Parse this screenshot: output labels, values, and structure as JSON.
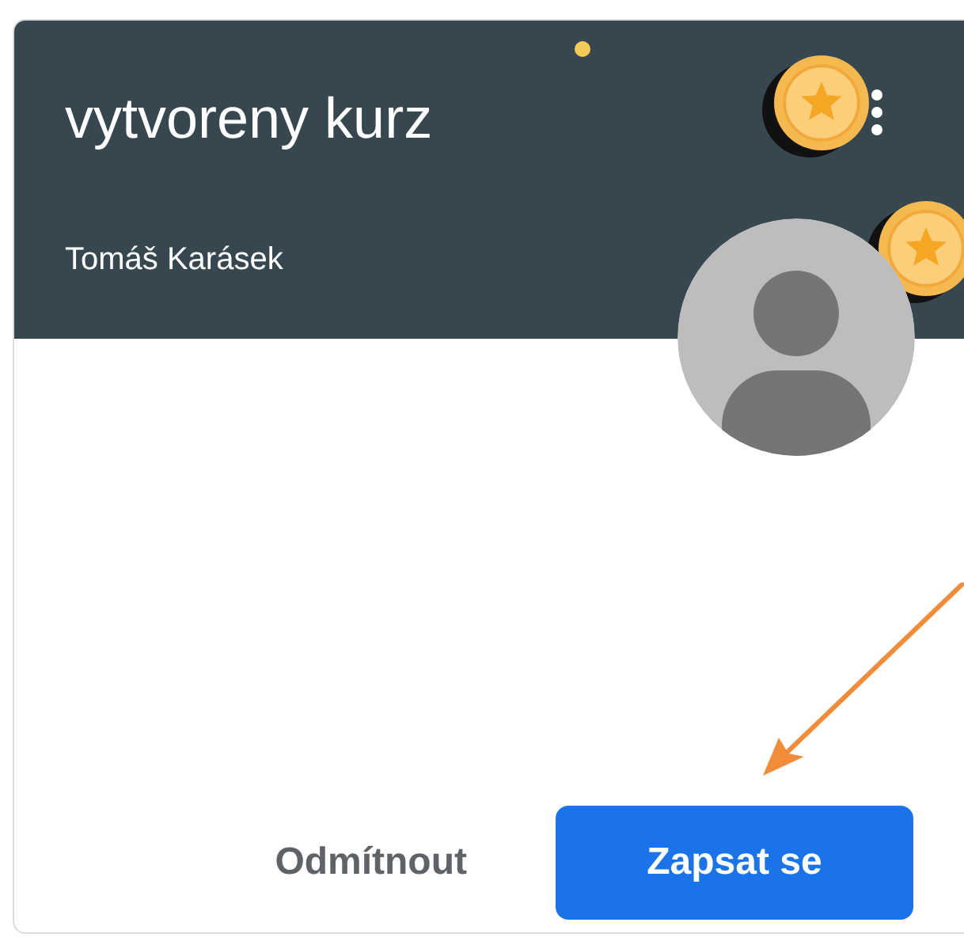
{
  "card": {
    "title": "vytvoreny kurz",
    "teacher": "Tomáš Karásek"
  },
  "buttons": [
    {
      "label": "Odmítnout",
      "kind": "text"
    },
    {
      "label": "Zapsat se",
      "kind": "primary"
    }
  ]
}
